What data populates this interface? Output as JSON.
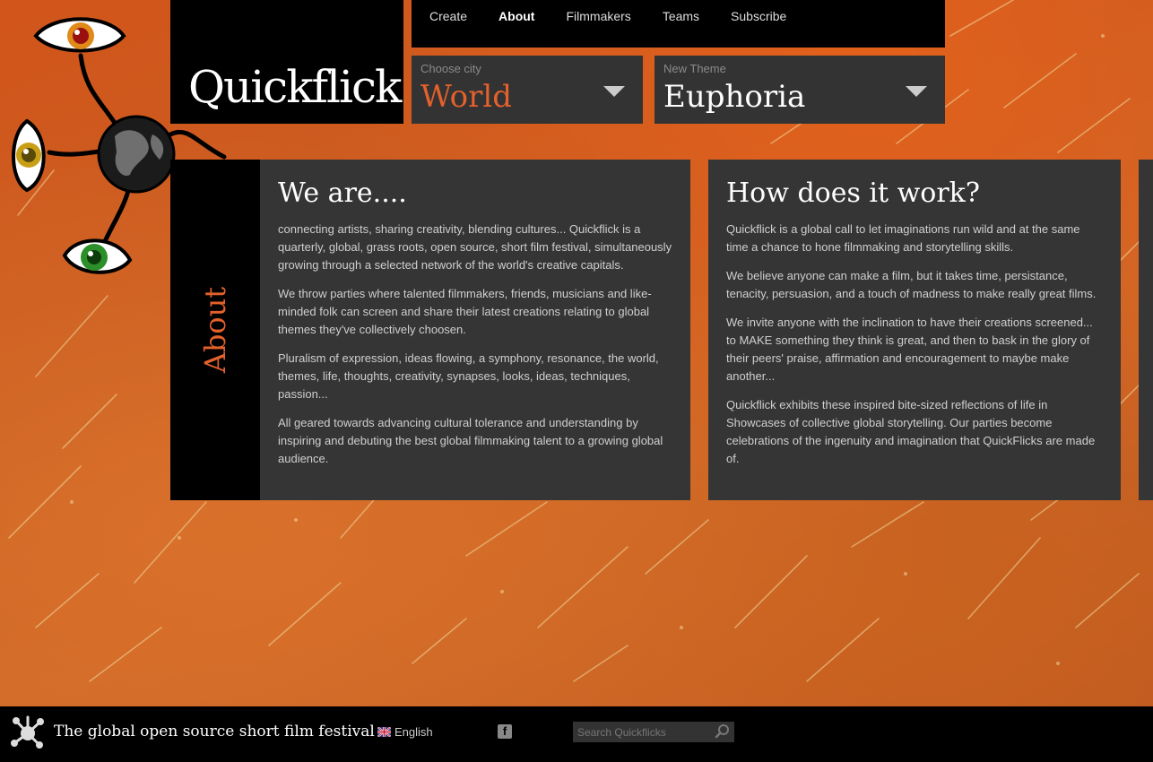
{
  "site": {
    "logo_text": "Quickflick"
  },
  "nav": {
    "items": [
      "Create",
      "About",
      "Filmmakers",
      "Teams",
      "Subscribe"
    ],
    "active": "About"
  },
  "city_select": {
    "label": "Choose city",
    "value": "World"
  },
  "theme_select": {
    "label": "New Theme",
    "value": "Euphoria"
  },
  "side_tab": {
    "label": "About"
  },
  "panels": [
    {
      "title": "We are....",
      "paragraphs": [
        "connecting artists, sharing creativity, blending cultures... Quickflick is a quarterly, global, grass roots, open source, short film festival, simultaneously growing through a selected network of the world's creative capitals.",
        "We throw parties where talented filmmakers, friends, musicians and like-minded folk can screen and share their latest creations relating to global themes they've collectively choosen.",
        "Pluralism of expression, ideas flowing, a symphony, resonance, the world, themes, life, thoughts, creativity, synapses, looks, ideas, techniques, passion...",
        "All geared towards advancing cultural tolerance and understanding by inspiring and debuting the best global filmmaking talent to a growing global audience."
      ]
    },
    {
      "title": "How does it work?",
      "paragraphs": [
        "Quickflick is a global call to let imaginations run wild and at the same time a chance to hone filmmaking and storytelling skills.",
        "We believe anyone can make a film, but it takes time, persistance, tenacity, persuasion, and a touch of madness to make really great films.",
        "We invite anyone with the inclination to have their creations screened... to MAKE something they think is great, and then to bask in the glory of their peers' praise, affirmation and encouragement to maybe make another...",
        "Quickflick exhibits these inspired bite-sized reflections of life in Showcases of collective global storytelling. Our parties become celebrations of the ingenuity and imagination that QuickFlicks are made of."
      ]
    }
  ],
  "footer": {
    "tagline": "The global open source short film festival",
    "language": "English",
    "social_icon": "facebook-icon",
    "search_placeholder": "Search Quickflicks"
  },
  "colors": {
    "accent": "#e3612b",
    "panel": "#353535",
    "bar": "#000000"
  }
}
